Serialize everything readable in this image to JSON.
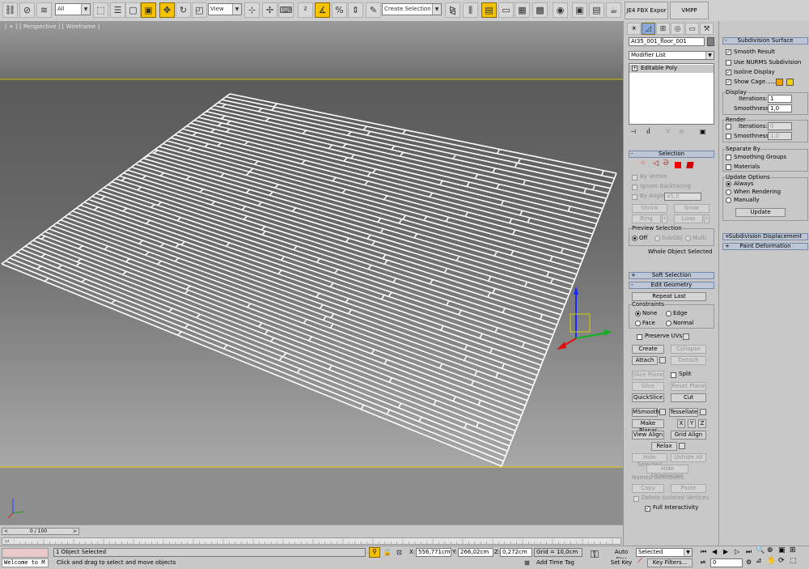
{
  "toolbar": {
    "selection_filter": "All",
    "reference_coord": "View",
    "named_selection_placeholder": "Create Selection Se"
  },
  "right_tabs": {
    "fbx_export": "JE4 FBX Expor",
    "vmpp": "VMPP"
  },
  "viewport": {
    "label": "[ + ] [ Perspective ] [ Wireframe ]"
  },
  "modify_panel": {
    "object_name": "AI35_001_floor_001",
    "modifier_list": "Modifier List",
    "stack_item": "Editable Poly"
  },
  "selection_rollout": {
    "title": "Selection",
    "by_vertex": "By Vertex",
    "ignore_backfacing": "Ignore Backfacing",
    "by_angle": "By Angle:",
    "angle_value": "45,0",
    "shrink": "Shrink",
    "grow": "Grow",
    "ring": "Ring",
    "loop": "Loop",
    "preview_selection": "Preview Selection",
    "off": "Off",
    "subobj": "SubObj",
    "multi": "Multi",
    "whole_object": "Whole Object Selected"
  },
  "soft_selection": {
    "title": "Soft Selection"
  },
  "edit_geometry": {
    "title": "Edit Geometry",
    "repeat_last": "Repeat Last",
    "constraints": "Constraints",
    "none": "None",
    "edge": "Edge",
    "face": "Face",
    "normal": "Normal",
    "preserve_uvs": "Preserve UVs",
    "create": "Create",
    "collapse": "Collapse",
    "attach": "Attach",
    "detach": "Detach",
    "slice_plane": "Slice Plane",
    "split": "Split",
    "slice": "Slice",
    "reset_plane": "Reset Plane",
    "quickslice": "QuickSlice",
    "cut": "Cut",
    "msmooth": "MSmooth",
    "tessellate": "Tessellate",
    "make_planar": "Make Planar",
    "x": "X",
    "y": "Y",
    "z": "Z",
    "view_align": "View Align",
    "grid_align": "Grid Align",
    "relax": "Relax",
    "hide_selected": "Hide Selected",
    "unhide_all": "Unhide All",
    "hide_unselected": "Hide Unselected",
    "named_selections": "Named Selections:",
    "copy": "Copy",
    "paste": "Paste",
    "delete_isolated": "Delete Isolated Vertices",
    "full_interactivity": "Full Interactivity"
  },
  "subdivision": {
    "title": "Subdivision Surface",
    "smooth_result": "Smooth Result",
    "use_nurms": "Use NURMS Subdivision",
    "isoline_display": "Isoline Display",
    "show_cage": "Show Cage......",
    "display": "Display",
    "iterations_label": "Iterations:",
    "iterations_value": "1",
    "smoothness_label": "Smoothness:",
    "smoothness_value": "1,0",
    "render": "Render",
    "r_iterations_value": "0",
    "r_smoothness_value": "1,0",
    "separate_by": "Separate By",
    "smoothing_groups": "Smoothing Groups",
    "materials": "Materials",
    "update_options": "Update Options",
    "always": "Always",
    "when_rendering": "When Rendering",
    "manually": "Manually",
    "update": "Update",
    "cage_color1": "#f0a000",
    "cage_color2": "#f4d000"
  },
  "subdivision_displacement": {
    "title": "Subdivision Displacement"
  },
  "paint_deformation": {
    "title": "Paint Deformation"
  },
  "timeline": {
    "frame": "0 / 100"
  },
  "status": {
    "maxscript": "Welcome to M",
    "selected": "1 Object Selected",
    "prompt": "Click and drag to select and move objects",
    "x_label": "X:",
    "x_value": "556,771cm",
    "y_label": "Y:",
    "y_value": "266,02cm",
    "z_label": "Z:",
    "z_value": "0,272cm",
    "grid": "Grid = 10,0cm",
    "add_time_tag": "Add Time Tag",
    "auto_key": "Auto Key",
    "auto_key_value": "Selected",
    "set_key": "Set Key",
    "key_filters": "Key Filters...",
    "frame_value": "0"
  }
}
